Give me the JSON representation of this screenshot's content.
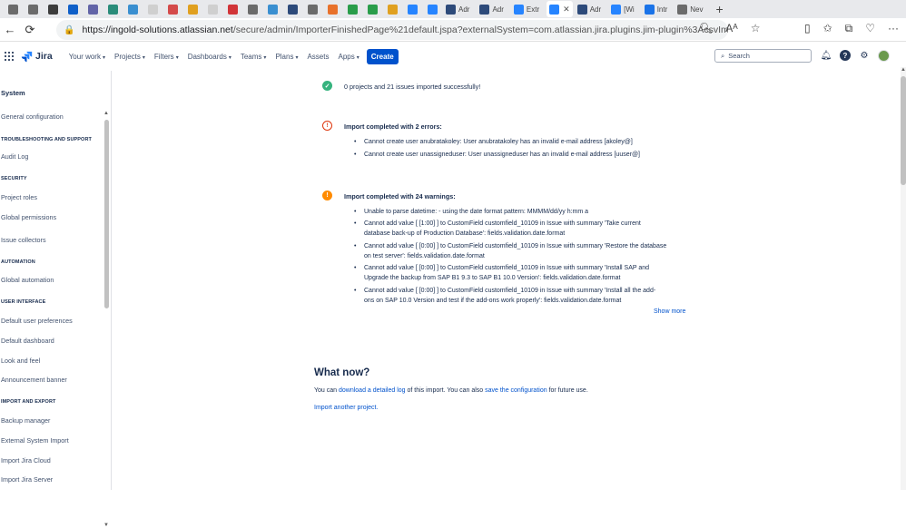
{
  "browser": {
    "tabs": [
      {
        "icon": "app-icon",
        "color": "#6b6b6b",
        "label": ""
      },
      {
        "icon": "app-icon",
        "color": "#6b6b6b",
        "label": ""
      },
      {
        "icon": "app-icon",
        "color": "#3c3c3c",
        "label": ""
      },
      {
        "icon": "outlook-icon",
        "color": "#0f5fc8",
        "label": ""
      },
      {
        "icon": "teams-icon",
        "color": "#6264a7",
        "label": ""
      },
      {
        "icon": "app-icon",
        "color": "#2a8c7a",
        "label": ""
      },
      {
        "icon": "app-icon",
        "color": "#3a8fd0",
        "label": ""
      },
      {
        "icon": "app-icon",
        "color": "#cfcfcf",
        "label": ""
      },
      {
        "icon": "app-icon",
        "color": "#d44a4a",
        "label": ""
      },
      {
        "icon": "app-icon",
        "color": "#e0a020",
        "label": ""
      },
      {
        "icon": "app-icon",
        "color": "#cfcfcf",
        "label": ""
      },
      {
        "icon": "app-icon",
        "color": "#d13438",
        "label": ""
      },
      {
        "icon": "app-icon",
        "color": "#6b6b6b",
        "label": ""
      },
      {
        "icon": "app-icon",
        "color": "#3a8fd0",
        "label": ""
      },
      {
        "icon": "atlassian-icon",
        "color": "#2d4a7a",
        "label": ""
      },
      {
        "icon": "app-icon",
        "color": "#6b6b6b",
        "label": ""
      },
      {
        "icon": "app-icon",
        "color": "#e8712b",
        "label": ""
      },
      {
        "icon": "app-icon",
        "color": "#2a9d4a",
        "label": ""
      },
      {
        "icon": "app-icon",
        "color": "#2a9d4a",
        "label": ""
      },
      {
        "icon": "app-icon",
        "color": "#e0a020",
        "label": ""
      },
      {
        "icon": "jira-icon",
        "color": "#2684ff",
        "label": ""
      },
      {
        "icon": "jira-icon",
        "color": "#2684ff",
        "label": ""
      },
      {
        "icon": "atlassian-icon",
        "color": "#2d4a7a",
        "label": "Adr"
      },
      {
        "icon": "atlassian-icon",
        "color": "#2d4a7a",
        "label": "Adr"
      },
      {
        "icon": "jira-icon",
        "color": "#2684ff",
        "label": "Extr"
      },
      {
        "icon": "jira-icon",
        "color": "#2684ff",
        "label": "",
        "active": true
      },
      {
        "icon": "atlassian-icon",
        "color": "#2d4a7a",
        "label": "Adr"
      },
      {
        "icon": "jira-icon",
        "color": "#2684ff",
        "label": "[Wi"
      },
      {
        "icon": "app-icon",
        "color": "#1a73e8",
        "label": "Intr"
      },
      {
        "icon": "page-icon",
        "color": "#6b6b6b",
        "label": "Nev"
      }
    ],
    "url_host": "https://ingold-solutions.atlassian.net",
    "url_path": "/secure/admin/ImporterFinishedPage%21default.jspa?externalSystem=com.atlassian.jira.plugins.jim-plugin%3AcsvImporter...",
    "read_aloud_label": "Aᴬ"
  },
  "jira": {
    "product": "Jira",
    "nav": [
      "Your work",
      "Projects",
      "Filters",
      "Dashboards",
      "Teams",
      "Plans",
      "Assets",
      "Apps"
    ],
    "nav_has_caret": [
      true,
      true,
      true,
      true,
      true,
      true,
      false,
      true
    ],
    "create": "Create",
    "search_placeholder": "Search"
  },
  "sidebar": {
    "title": "System",
    "entries": [
      {
        "type": "item",
        "label": "General configuration"
      },
      {
        "type": "head",
        "label": "TROUBLESHOOTING AND SUPPORT"
      },
      {
        "type": "item",
        "label": "Audit Log"
      },
      {
        "type": "head",
        "label": "SECURITY"
      },
      {
        "type": "item",
        "label": "Project roles"
      },
      {
        "type": "item",
        "label": "Global permissions"
      },
      {
        "type": "item",
        "label": "Issue collectors"
      },
      {
        "type": "head",
        "label": "AUTOMATION"
      },
      {
        "type": "item",
        "label": "Global automation"
      },
      {
        "type": "head",
        "label": "USER INTERFACE"
      },
      {
        "type": "item",
        "label": "Default user preferences"
      },
      {
        "type": "item",
        "label": "Default dashboard"
      },
      {
        "type": "item",
        "label": "Look and feel"
      },
      {
        "type": "item",
        "label": "Announcement banner"
      },
      {
        "type": "head",
        "label": "IMPORT AND EXPORT"
      },
      {
        "type": "item",
        "label": "Backup manager"
      },
      {
        "type": "item",
        "label": "External System Import"
      },
      {
        "type": "item",
        "label": "Import Jira Cloud"
      },
      {
        "type": "item",
        "label": "Import Jira Server"
      }
    ]
  },
  "results": {
    "success": "0 projects and 21 issues imported successfully!",
    "errors_title": "Import completed with 2 errors:",
    "errors": [
      "Cannot create user anubratakoley: User anubratakoley has an invalid e-mail address [akoley@]",
      "Cannot create user unassigneduser: User unassigneduser has an invalid e-mail address [uuser@]"
    ],
    "warnings_title": "Import completed with 24 warnings:",
    "warnings": [
      [
        "Unable to parse datetime: - using the date format pattern: MMMM/dd/yy h:mm a"
      ],
      [
        "Cannot add value [ [1:00] ] to CustomField customfield_10109 in Issue with summary 'Take current",
        "database back-up of Production Database': fields.validation.date.format"
      ],
      [
        "Cannot add value [ [0:00] ] to CustomField customfield_10109 in Issue with summary 'Restore the database",
        "on test server': fields.validation.date.format"
      ],
      [
        "Cannot add value [ [0:00] ] to CustomField customfield_10109 in Issue with summary 'Install SAP and",
        "Upgrade the backup from SAP B1 9.3 to SAP B1 10.0 Version': fields.validation.date.format"
      ],
      [
        "Cannot add value [ [0:00] ] to CustomField customfield_10109 in Issue with summary 'Install all the add-",
        "ons on SAP 10.0 Version and test if the add-ons work properly': fields.validation.date.format"
      ]
    ],
    "show_more": "Show more"
  },
  "what_now": {
    "heading": "What now?",
    "p1_a": "You can ",
    "p1_link1": "download a detailed log",
    "p1_b": " of this import. You can also ",
    "p1_link2": "save the configuration",
    "p1_c": " for future use.",
    "import_another": "Import another project."
  }
}
